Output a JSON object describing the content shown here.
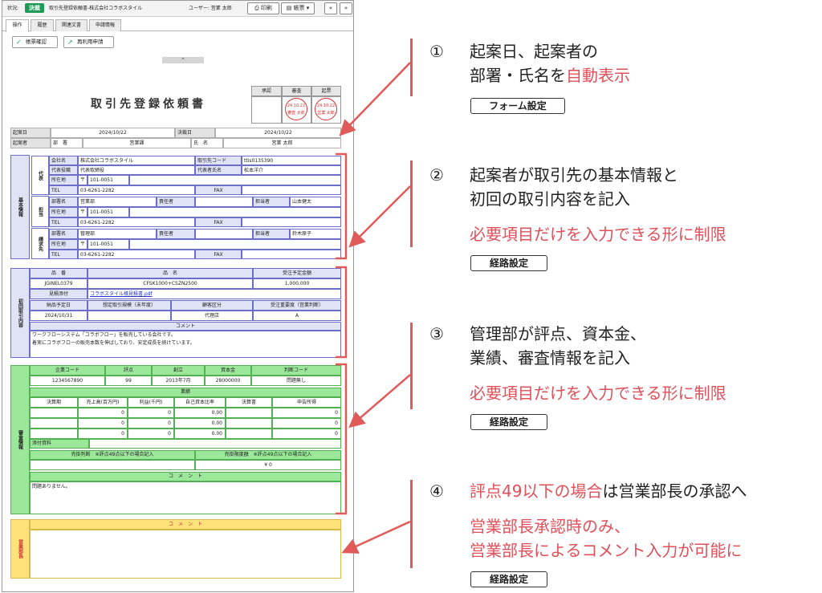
{
  "topbar": {
    "status_label": "状況:",
    "status_badge": "決裁",
    "doc_title": "取引先登録依頼書-株式会社コラボスタイル",
    "user_label": "ユーザー: 営業 太郎",
    "print": "印刷",
    "forms": "帳票",
    "prev": "«",
    "next": "»"
  },
  "tabs": [
    "操作",
    "履歴",
    "関連文書",
    "申請情報"
  ],
  "actions": {
    "confirm": "帳票確認",
    "reuse": "再利用申請"
  },
  "collapse_icon": "chevron-up-icon",
  "form": {
    "title": "取引先登録依頼書",
    "stamps": {
      "headers": [
        "承認",
        "審査",
        "起票"
      ],
      "review": {
        "date": "24.10.22",
        "name": "審査 太郎"
      },
      "draft": {
        "date": "24.10.22",
        "name": "営業 太郎"
      }
    },
    "header": {
      "draft_date_label": "起案日",
      "draft_date": "2024/10/22",
      "approve_date_label": "決裁日",
      "approve_date": "2024/10/22",
      "drafter_label": "起案者",
      "dept_label": "部　署",
      "dept": "営業課",
      "name_label": "氏　名",
      "name": "営業 太郎"
    },
    "basic": {
      "section": "基本情報",
      "rep_label": "代表",
      "contact_label": "担当",
      "billing_label": "請求先",
      "company_label": "会社名",
      "company": "株式会社コラボスタイル",
      "code_label": "取引先コード",
      "code": "ttis0135390",
      "rep_title_label": "代表役職",
      "rep_title": "代表取締役",
      "rep_name_label": "代表者氏名",
      "rep_name": "松本洋介",
      "addr_label": "所在地",
      "postal_mark": "〒",
      "postal": "101-0051",
      "tel_label": "TEL",
      "tel": "03-6261-2282",
      "fax_label": "FAX",
      "dept_label": "部署名",
      "contact_dept": "営業部",
      "person_label": "責任者",
      "staff_label": "担当者",
      "contact_staff": "山本健太",
      "billing_dept": "管理部",
      "billing_staff": "鈴木原子"
    },
    "initial": {
      "section": "初回取引内容",
      "col_no": "品　番",
      "col_name": "品　名",
      "col_amount": "受注予定金額",
      "no": "JGINEL0379",
      "name": "CFSK1000+CSZN2500",
      "amount": "1,000,000",
      "quote_label": "見積添付",
      "quote_file": "コラボスタイル様見積書.pdf",
      "delivery_label": "納品予定日",
      "volume_label": "想定取引規模（未年度）",
      "customer_label": "顧客区分",
      "importance_label": "受注重要度（営業判断）",
      "delivery": "2024/10/31",
      "customer": "代理店",
      "importance": "A",
      "comment_label": "コメント",
      "comment_1": "ワークフローシステム「コラボフロー」を販売している会社です。",
      "comment_2": "着実にコラボフローの販売本数を伸ばしており、安定成長を続けています。"
    },
    "review": {
      "section": "審査情報",
      "h_code": "企業コード",
      "h_score": "評点",
      "h_founded": "創立",
      "h_capital": "資本金",
      "h_judge": "判断コード",
      "code": "1234567890",
      "score": "99",
      "founded": "2013年7月",
      "capital": "28000000",
      "judge": "問題無し",
      "results": "業績",
      "r_period": "決算期",
      "r_sales": "売上高(百万円)",
      "r_profit": "利益(千円)",
      "r_equity": "自己資本比率",
      "r_statement": "決算書",
      "r_tax": "申告所得",
      "rows": [
        [
          "",
          "0",
          "0",
          "0.00",
          "",
          "0"
        ],
        [
          "",
          "0",
          "0",
          "0.00",
          "",
          "0"
        ],
        [
          "",
          "0",
          "0",
          "0.00",
          "",
          "0"
        ]
      ],
      "attach_label": "添付資料",
      "judge_label": "売掛判断　※評点49点以下の場合記入",
      "limit_label": "売掛限度額　※評点49点以下の場合記入",
      "limit_value": "¥ 0",
      "comment_label": "コ　メ　ン　ト",
      "comment": "問題ありません。"
    },
    "manager": {
      "section": "営業部長",
      "comment_label": "コ　メ　ン　ト"
    }
  },
  "annotations": [
    {
      "num": "①",
      "line1": "起案日、起案者の",
      "line2_a": "部署・氏名を",
      "line2_b": "自動表示",
      "button": "フォーム設定"
    },
    {
      "num": "②",
      "line1": "起案者が取引先の基本情報と",
      "line2": "初回の取引内容を記入",
      "red": "必要項目だけを入力できる形に制限",
      "button": "経路設定"
    },
    {
      "num": "③",
      "line1": "管理部が評点、資本金、",
      "line2": "業績、審査情報を記入",
      "red": "必要項目だけを入力できる形に制限",
      "button": "経路設定"
    },
    {
      "num": "④",
      "line1_a": "評点49以下の場合",
      "line1_b": "は営業部長の承認へ",
      "red1": "営業部長承認時のみ、",
      "red2": "営業部長によるコメント入力が可能に",
      "button": "経路設定"
    }
  ],
  "colors": {
    "accent_red": "#e0505a",
    "status_green": "#1f9b57",
    "basic_blue": "#6b6fc9",
    "review_green": "#52b152",
    "manager_yellow": "#ffe27a"
  }
}
